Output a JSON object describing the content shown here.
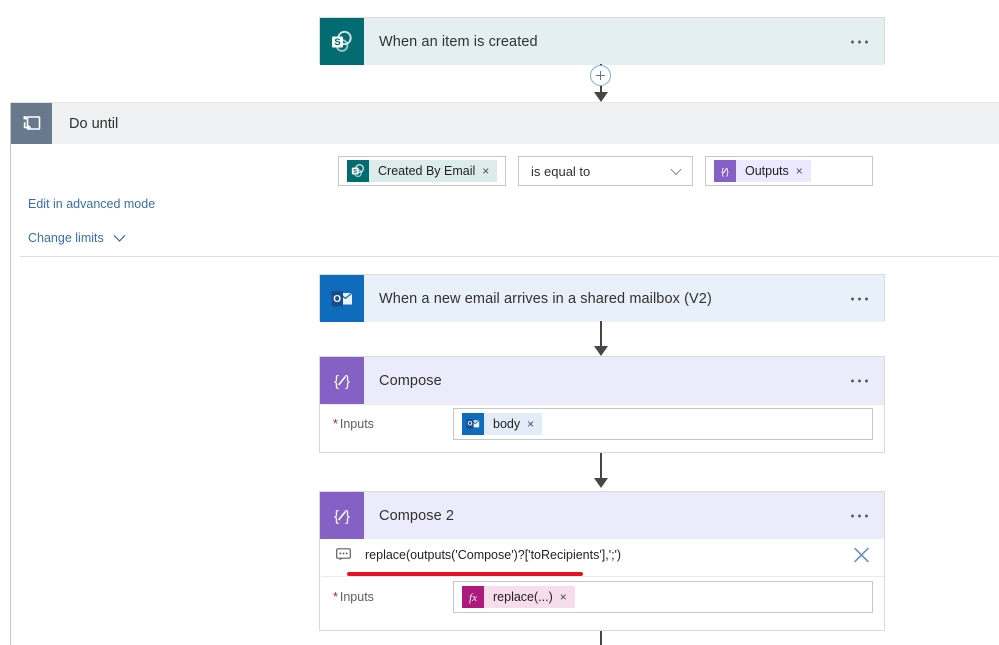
{
  "trigger": {
    "title": "When an item is created",
    "icon": "sharepoint-icon",
    "menu": "more-commands"
  },
  "do_until": {
    "title": "Do until",
    "icon": "do-until-loop-icon",
    "links": {
      "advanced_mode": "Edit in advanced mode",
      "change_limits": "Change limits"
    },
    "condition": {
      "left_token": {
        "label": "Created By Email",
        "icon": "sharepoint-icon",
        "remove": "×"
      },
      "operator": "is equal to",
      "right_token": {
        "label": "Outputs",
        "icon": "compose-braces-icon",
        "remove": "×"
      }
    }
  },
  "actions": [
    {
      "id": "outlook-trigger",
      "title": "When a new email arrives in a shared mailbox (V2)",
      "icon": "outlook-icon",
      "menu": "more-commands"
    },
    {
      "id": "compose",
      "title": "Compose",
      "icon": "compose-braces-icon",
      "menu": "more-commands",
      "input_label": "Inputs",
      "required": "*",
      "token": {
        "label": "body",
        "icon": "outlook-icon",
        "remove": "×"
      }
    },
    {
      "id": "compose-2",
      "title": "Compose 2",
      "icon": "compose-braces-icon",
      "menu": "more-commands",
      "expression": "replace(outputs('Compose')?['toRecipients'],';')",
      "expression_icon": "tooltip-balloon-icon",
      "close": "close-icon",
      "input_label": "Inputs",
      "required": "*",
      "token": {
        "label": "replace(...)",
        "icon": "fx-expression-icon",
        "remove": "×"
      }
    }
  ],
  "add_button": {
    "icon": "plus-icon"
  },
  "colors": {
    "sharepoint_teal": "#036c70",
    "outlook_blue": "#0f6cbd",
    "compose_purple": "#8661c5",
    "fx_magenta": "#ad1a7b",
    "scope_grey": "#69798d",
    "error_red": "#e81123",
    "link_blue": "#3a6fa7"
  }
}
